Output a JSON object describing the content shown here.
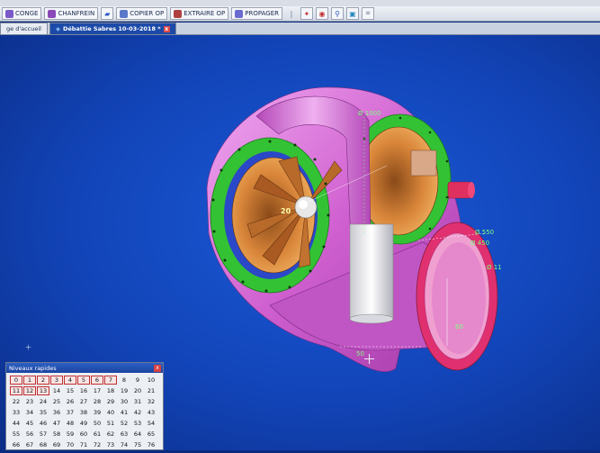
{
  "toolbar": {
    "buttons": [
      {
        "label": "CONGE",
        "icon": "fillet-icon"
      },
      {
        "label": "CHANFREIN",
        "icon": "chamfer-icon"
      },
      {
        "label": "COPIER OP",
        "icon": "copy-op-icon"
      },
      {
        "label": "EXTRAIRE OP",
        "icon": "extract-op-icon"
      },
      {
        "label": "PROPAGER",
        "icon": "propagate-icon"
      }
    ]
  },
  "tabs": [
    {
      "label": "ge d'accueil",
      "active": false
    },
    {
      "label": "Débattie Sabres 10-03-2018 *",
      "active": true
    }
  ],
  "dimensions": {
    "top_diameter": "Ø 1000",
    "center_value": "20",
    "d550": "Ø 550",
    "d450": "Ø 450",
    "d11": "Ø 11",
    "v50": "50",
    "v60": "60"
  },
  "panel": {
    "title": "Niveaux rapides",
    "close": "x",
    "rows": [
      [
        "0",
        "1",
        "2",
        "3",
        "4",
        "5",
        "6",
        "7",
        "8",
        "9",
        "10"
      ],
      [
        "11",
        "12",
        "13",
        "14",
        "15",
        "16",
        "17",
        "18",
        "19",
        "20",
        "21"
      ],
      [
        "22",
        "23",
        "24",
        "25",
        "26",
        "27",
        "28",
        "29",
        "30",
        "31",
        "32"
      ],
      [
        "33",
        "34",
        "35",
        "36",
        "37",
        "38",
        "39",
        "40",
        "41",
        "42",
        "43"
      ],
      [
        "44",
        "45",
        "46",
        "47",
        "48",
        "49",
        "50",
        "51",
        "52",
        "53",
        "54"
      ],
      [
        "55",
        "56",
        "57",
        "58",
        "59",
        "60",
        "61",
        "62",
        "63",
        "64",
        "65"
      ],
      [
        "66",
        "67",
        "68",
        "69",
        "70",
        "71",
        "72",
        "73",
        "74",
        "75",
        "76"
      ]
    ],
    "highlighted": [
      "0",
      "1",
      "2",
      "3",
      "4",
      "5",
      "6",
      "7",
      "11",
      "12",
      "13"
    ]
  }
}
